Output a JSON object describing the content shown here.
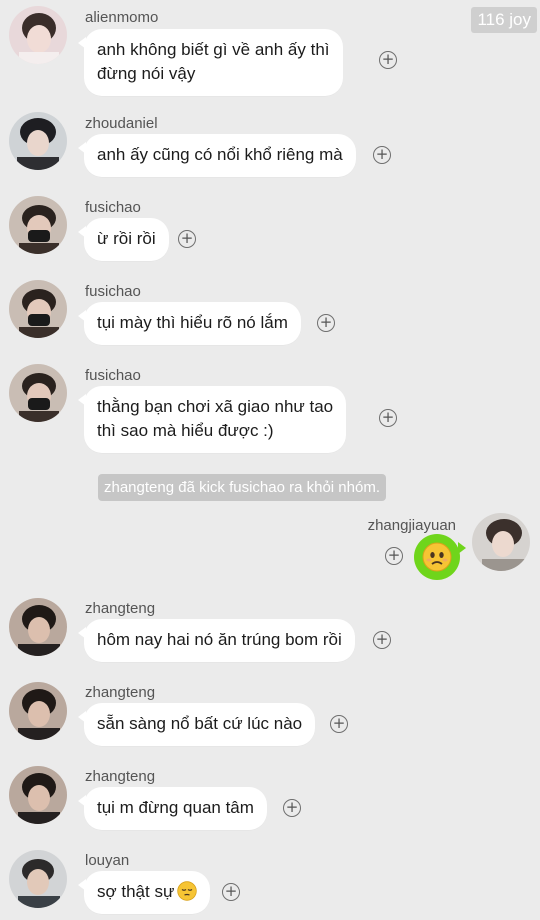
{
  "watermark": "116 joy",
  "system_notice": "zhangteng đã kick fusichao ra khỏi nhóm.",
  "messages": [
    {
      "user": "alienmomo",
      "lines": [
        "anh không biết gì về anh ấy thì",
        "đừng nói vậy"
      ]
    },
    {
      "user": "zhoudaniel",
      "lines": [
        "anh ấy cũng có nổi khổ riêng mà"
      ]
    },
    {
      "user": "fusichao",
      "lines": [
        "ừ rồi rồi"
      ]
    },
    {
      "user": "fusichao",
      "lines": [
        "tụi mày thì hiểu rõ nó lắm"
      ]
    },
    {
      "user": "fusichao",
      "lines": [
        "thằng bạn chơi xã giao như tao",
        "thì sao mà hiểu được :)"
      ]
    },
    {
      "user": "zhangjiayuan",
      "emoji": "worried-face"
    },
    {
      "user": "zhangteng",
      "lines": [
        "hôm nay hai nó ăn trúng bom rồi"
      ]
    },
    {
      "user": "zhangteng",
      "lines": [
        "sẵn sàng nổ bất cứ lúc nào"
      ]
    },
    {
      "user": "zhangteng",
      "lines": [
        "tụi m đừng quan tâm"
      ]
    },
    {
      "user": "louyan",
      "lines": [
        "sợ thật sự"
      ],
      "emoji": "pensive-face"
    }
  ],
  "react_symbol": "+",
  "colors": {
    "background": "#ebebeb",
    "bubble": "#ffffff",
    "self_bubble": "#6fd51b",
    "system": "#c6c6c6"
  }
}
